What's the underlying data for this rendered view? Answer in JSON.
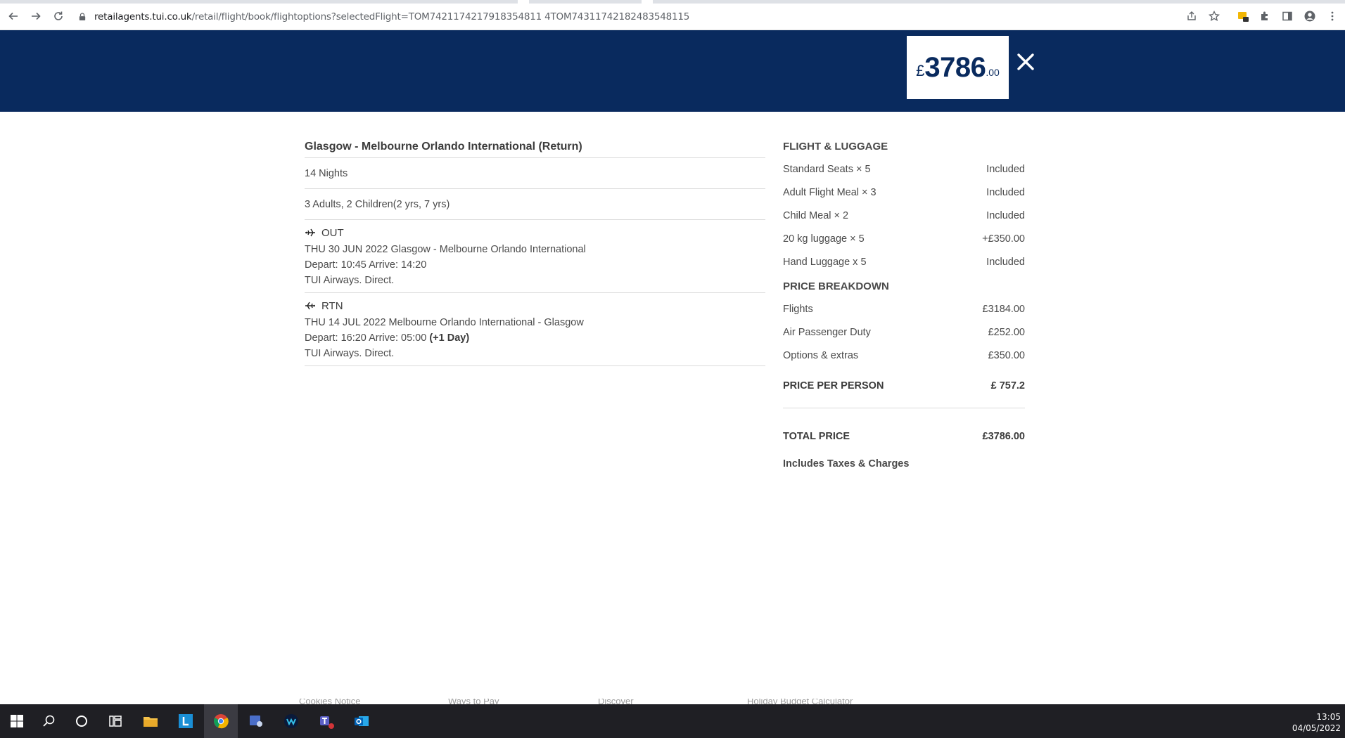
{
  "browser": {
    "url_domain": "retailagents.tui.co.uk",
    "url_path": "/retail/flight/book/flightoptions?selectedFlight=TOM7421174217918354811 4TOM74311742182483548115"
  },
  "header": {
    "price_currency": "£",
    "price_main": "3786",
    "price_decimals": ".00",
    "colors": {
      "band": "#092a5e"
    }
  },
  "summary": {
    "route_title": "Glasgow - Melbourne Orlando International (Return)",
    "nights": "14 Nights",
    "passengers": "3  Adults, 2  Children(2  yrs, 7  yrs)",
    "out": {
      "label": "OUT",
      "line1": "THU 30 JUN 2022 Glasgow  - Melbourne Orlando International",
      "line2": "Depart: 10:45 Arrive: 14:20",
      "line3": "TUI Airways. Direct."
    },
    "rtn": {
      "label": "RTN",
      "line1": "THU 14 JUL 2022 Melbourne Orlando International  - Glasgow",
      "line2": "Depart: 16:20 Arrive: 05:00",
      "line2_extra": "(+1 Day)",
      "line3": "TUI Airways. Direct."
    }
  },
  "flight_luggage": {
    "heading": "FLIGHT & LUGGAGE",
    "items": [
      {
        "label": "Standard Seats × 5",
        "value": "Included"
      },
      {
        "label": "Adult Flight Meal × 3",
        "value": "Included"
      },
      {
        "label": "Child Meal × 2",
        "value": "Included"
      },
      {
        "label": "20 kg luggage × 5",
        "value": "+£350.00"
      },
      {
        "label": "Hand Luggage x 5",
        "value": "Included"
      }
    ]
  },
  "price_breakdown": {
    "heading": "PRICE BREAKDOWN",
    "items": [
      {
        "label": "Flights",
        "value": "£3184.00"
      },
      {
        "label": "Air Passenger Duty",
        "value": "£252.00"
      },
      {
        "label": "Options & extras",
        "value": "£350.00"
      }
    ],
    "per_person_label": "PRICE PER PERSON",
    "per_person_value": "£ 757.2",
    "total_label": "TOTAL PRICE",
    "total_value": "£3786.00",
    "includes_note": "Includes Taxes & Charges"
  },
  "footer_links": [
    "Cookies Notice",
    "Ways to Pay",
    "Discover",
    "Holiday Budget Calculator"
  ],
  "taskbar": {
    "time": "13:05",
    "date": "04/05/2022",
    "apps": [
      "start-icon",
      "search-icon",
      "cortana-icon",
      "task-view-icon",
      "file-explorer-icon",
      "l-app-icon",
      "chrome-icon",
      "app-icon",
      "webex-icon",
      "teams-icon",
      "outlook-icon"
    ]
  }
}
